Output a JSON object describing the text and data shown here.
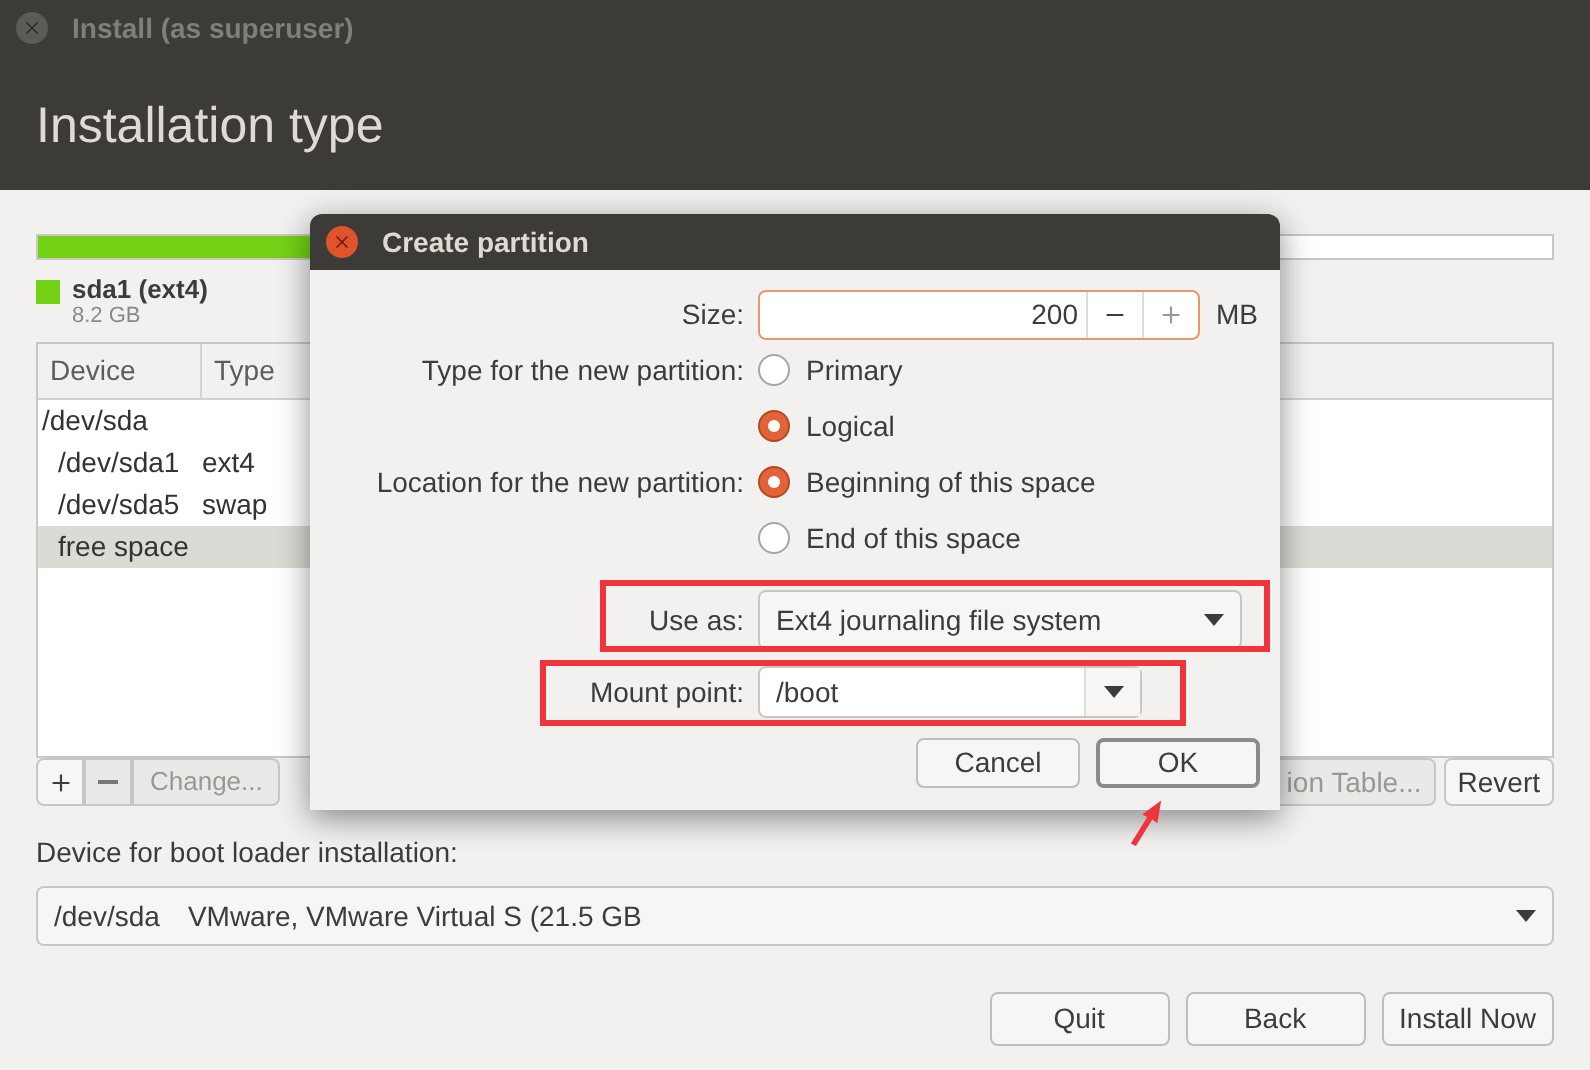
{
  "window": {
    "title": "Install (as superuser)"
  },
  "header": {
    "title": "Installation type"
  },
  "partition_bar": {
    "segments": [
      {
        "label": "sda1 (ext4)",
        "size": "8.2 GB",
        "color": "#73d216",
        "level": 0.4
      }
    ]
  },
  "table": {
    "columns": [
      "Device",
      "Type"
    ],
    "rows": [
      {
        "device": "/dev/sda",
        "selected": false
      },
      {
        "device": "/dev/sda1",
        "type": "ext4",
        "selected": false
      },
      {
        "device": "/dev/sda5",
        "type": "swap",
        "selected": false
      },
      {
        "device": "free space",
        "selected": true
      }
    ]
  },
  "table_buttons": [
    {
      "label": "Change...",
      "disabled": true
    }
  ],
  "right_buttons": [
    {
      "label": "ion Table...",
      "disabled": true
    },
    {
      "label": "Revert",
      "disabled": false
    }
  ],
  "boot_loader": {
    "label": "Device for boot loader installation:",
    "device": "/dev/sda",
    "description": "VMware, VMware Virtual S (21.5 GB"
  },
  "actions": [
    "Quit",
    "Back",
    "Install Now"
  ],
  "dialog": {
    "title": "Create partition",
    "size": {
      "label": "Size:",
      "value": "200",
      "unit": "MB"
    },
    "type": {
      "label": "Type for the new partition:",
      "options": [
        {
          "label": "Primary",
          "selected": false
        },
        {
          "label": "Logical",
          "selected": true
        }
      ]
    },
    "location": {
      "label": "Location for the new partition:",
      "options": [
        {
          "label": "Beginning of this space",
          "selected": true
        },
        {
          "label": "End of this space",
          "selected": false
        }
      ]
    },
    "use_as": {
      "label": "Use as:",
      "value": "Ext4 journaling file system"
    },
    "mount_point": {
      "label": "Mount point:",
      "value": "/boot"
    },
    "buttons": [
      "Cancel",
      "OK"
    ]
  }
}
